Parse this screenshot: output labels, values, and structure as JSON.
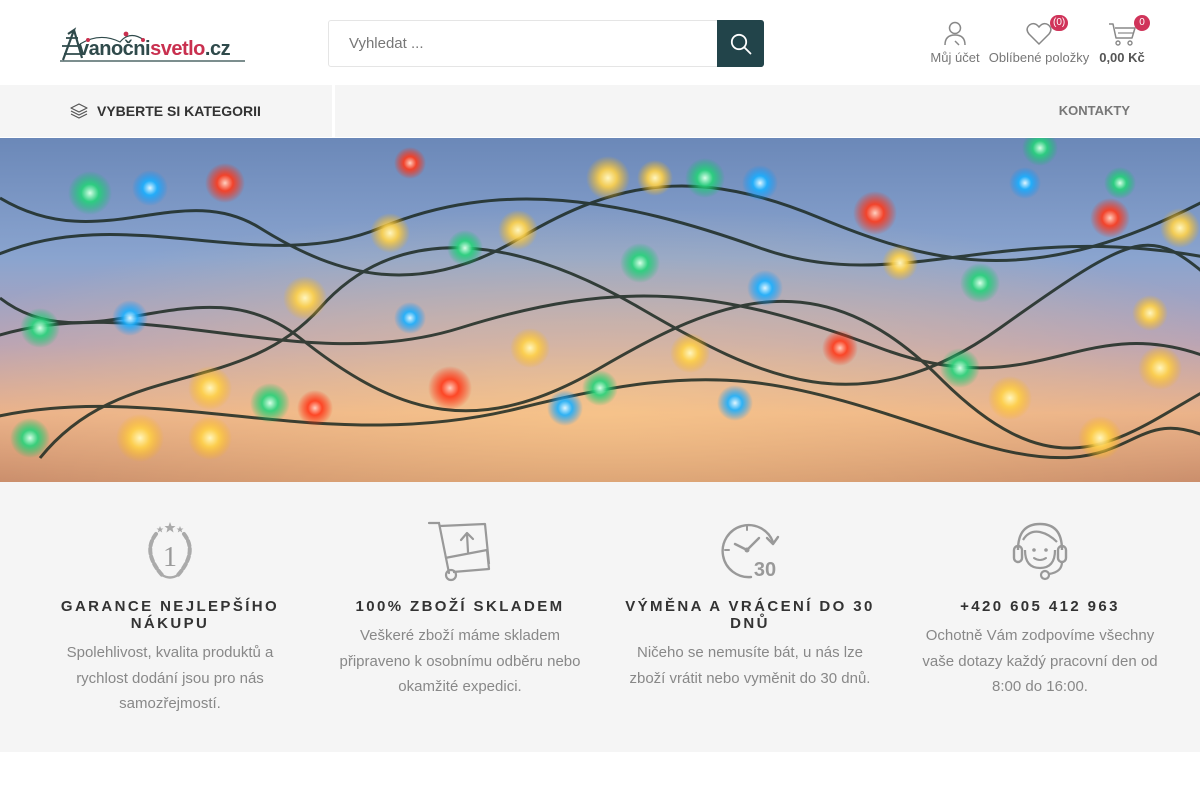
{
  "logo": {
    "part1": "vanočni",
    "part2": "svetlo",
    "part3": ".cz"
  },
  "search": {
    "placeholder": "Vyhledat ..."
  },
  "header": {
    "account_label": "Můj účet",
    "wishlist_label": "Oblíbené položky",
    "wishlist_count": "(0)",
    "cart_count": "0",
    "cart_total": "0,00 Kč"
  },
  "nav": {
    "categories_label": "VYBERTE SI KATEGORII",
    "contacts_label": "KONTAKTY"
  },
  "features": [
    {
      "title": "GARANCE NEJLEPŠÍHO NÁKUPU",
      "text": "Spolehlivost, kvalita produktů a rychlost dodání jsou pro nás samozřejmostí.",
      "icon": "award-1-icon"
    },
    {
      "title": "100% ZBOŽÍ SKLADEM",
      "text": "Veškeré zboží máme skladem připraveno k osobnímu odběru nebo okamžité expedici.",
      "icon": "cart-upload-icon"
    },
    {
      "title": "VÝMĚNA A VRÁCENÍ DO 30 DNŮ",
      "text": "Ničeho se nemusíte bát, u nás lze zboží vrátit nebo vyměnit do 30 dnů.",
      "icon": "clock-30-icon"
    },
    {
      "title": "+420 605 412 963",
      "text": "Ochotně Vám zodpovíme všechny vaše dotazy každý pracovní den od 8:00 do 16:00.",
      "icon": "headset-icon"
    }
  ],
  "colors": {
    "accent": "#22444a",
    "badge": "#d0345a",
    "background": "#f5f5f5"
  }
}
